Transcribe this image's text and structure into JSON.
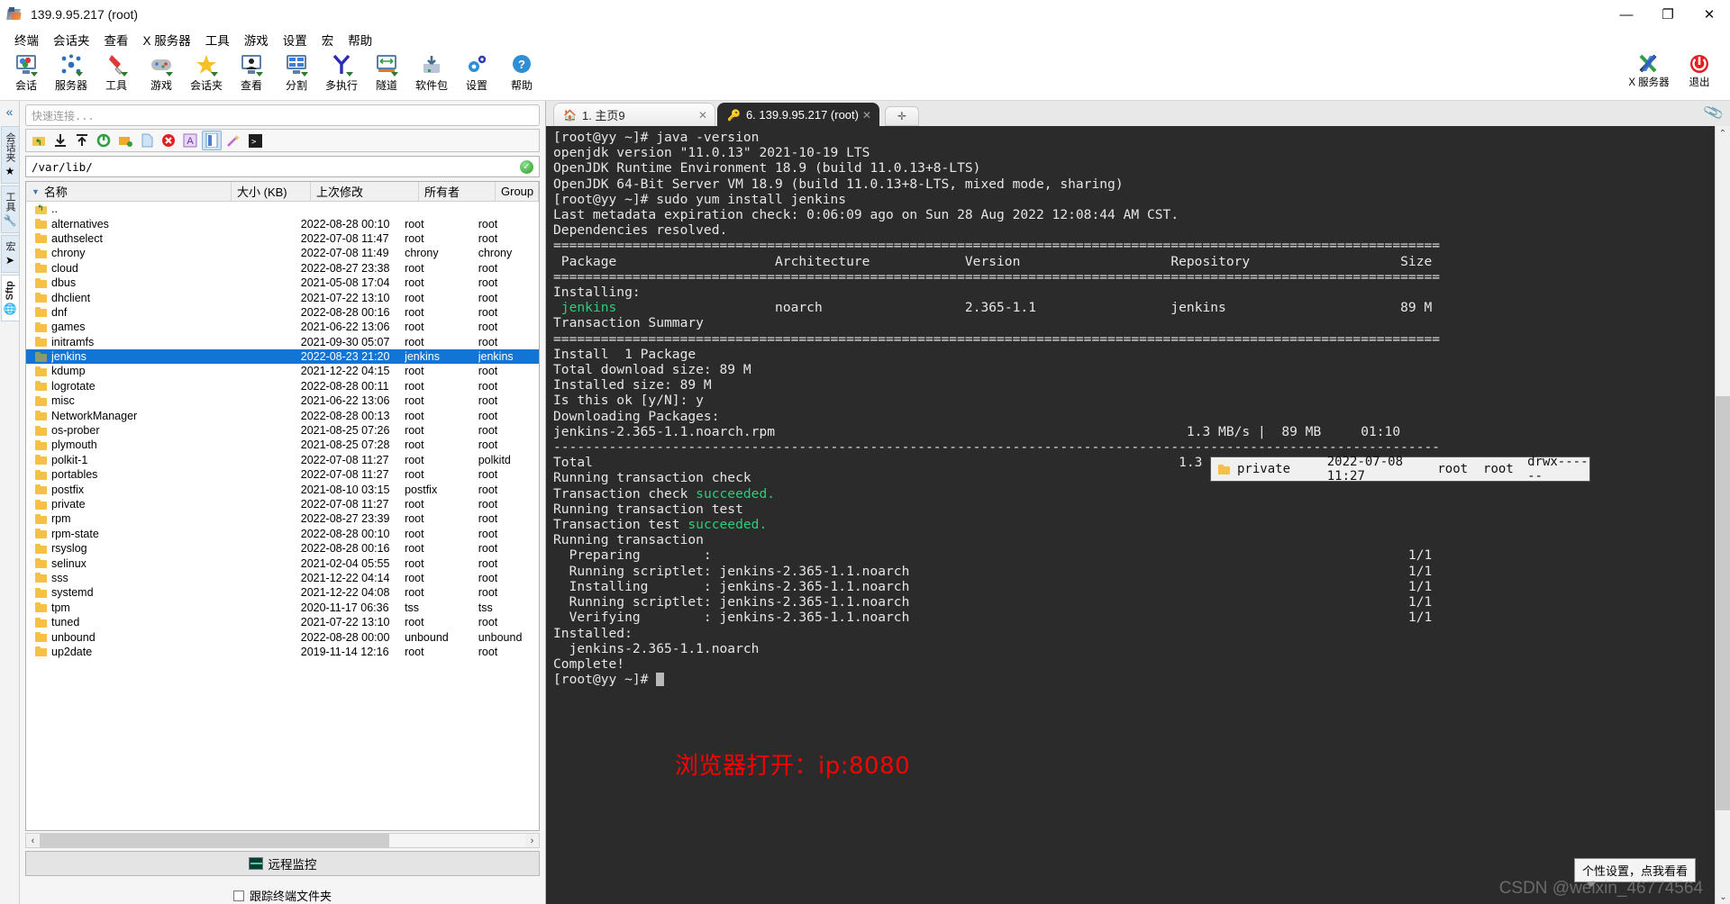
{
  "window": {
    "title": "139.9.95.217 (root)",
    "minimize": "—",
    "maximize": "❐",
    "close": "✕"
  },
  "menubar": [
    "终端",
    "会话夹",
    "查看",
    "X 服务器",
    "工具",
    "游戏",
    "设置",
    "宏",
    "帮助"
  ],
  "toolbar": {
    "buttons": [
      {
        "label": "会话",
        "icon": "session-icon"
      },
      {
        "label": "服务器",
        "icon": "servers-icon"
      },
      {
        "label": "工具",
        "icon": "tools-icon"
      },
      {
        "label": "游戏",
        "icon": "games-icon"
      },
      {
        "label": "会话夹",
        "icon": "sessions-folder-icon"
      },
      {
        "label": "查看",
        "icon": "view-icon"
      },
      {
        "label": "分割",
        "icon": "split-icon"
      },
      {
        "label": "多执行",
        "icon": "multiexec-icon"
      },
      {
        "label": "隧道",
        "icon": "tunneling-icon"
      },
      {
        "label": "软件包",
        "icon": "packages-icon"
      },
      {
        "label": "设置",
        "icon": "settings-icon"
      },
      {
        "label": "帮助",
        "icon": "help-icon"
      }
    ],
    "right_buttons": [
      {
        "label": "X 服务器",
        "icon": "xserver-icon"
      },
      {
        "label": "退出",
        "icon": "power-exit-icon"
      }
    ]
  },
  "rail": {
    "collapse": "«",
    "tabs": [
      {
        "label": "会话夹",
        "icon": "star-icon",
        "active": false
      },
      {
        "label": "工具",
        "icon": "swissknife-icon",
        "active": false
      },
      {
        "label": "宏",
        "icon": "paperplane-icon",
        "active": false
      },
      {
        "label": "Sftp",
        "icon": "globe-icon",
        "active": true
      }
    ]
  },
  "sftp": {
    "quick_connect_placeholder": "快速连接...",
    "toolbar_icons": [
      "up-folder-icon",
      "download-icon",
      "upload-icon",
      "refresh-icon",
      "new-folder-icon",
      "new-file-icon",
      "delete-icon",
      "rename-icon",
      "bookmark-icon",
      "wand-icon",
      "terminal-icon"
    ],
    "path": "/var/lib/",
    "path_ok_icon": "check-circle-icon",
    "columns": [
      "名称",
      "大小 (KB)",
      "上次修改",
      "所有者",
      "Group"
    ],
    "size_unit": "(KB)",
    "parent_entry": "..",
    "rows": [
      {
        "name": "alternatives",
        "size": "",
        "modified": "2022-08-28 00:10",
        "owner": "root",
        "group": "root"
      },
      {
        "name": "authselect",
        "size": "",
        "modified": "2022-07-08 11:47",
        "owner": "root",
        "group": "root"
      },
      {
        "name": "chrony",
        "size": "",
        "modified": "2022-07-08 11:49",
        "owner": "chrony",
        "group": "chrony"
      },
      {
        "name": "cloud",
        "size": "",
        "modified": "2022-08-27 23:38",
        "owner": "root",
        "group": "root"
      },
      {
        "name": "dbus",
        "size": "",
        "modified": "2021-05-08 17:04",
        "owner": "root",
        "group": "root"
      },
      {
        "name": "dhclient",
        "size": "",
        "modified": "2021-07-22 13:10",
        "owner": "root",
        "group": "root"
      },
      {
        "name": "dnf",
        "size": "",
        "modified": "2022-08-28 00:16",
        "owner": "root",
        "group": "root"
      },
      {
        "name": "games",
        "size": "",
        "modified": "2021-06-22 13:06",
        "owner": "root",
        "group": "root"
      },
      {
        "name": "initramfs",
        "size": "",
        "modified": "2021-09-30 05:07",
        "owner": "root",
        "group": "root"
      },
      {
        "name": "jenkins",
        "size": "",
        "modified": "2022-08-23 21:20",
        "owner": "jenkins",
        "group": "jenkins",
        "selected": true
      },
      {
        "name": "kdump",
        "size": "",
        "modified": "2021-12-22 04:15",
        "owner": "root",
        "group": "root"
      },
      {
        "name": "logrotate",
        "size": "",
        "modified": "2022-08-28 00:11",
        "owner": "root",
        "group": "root"
      },
      {
        "name": "misc",
        "size": "",
        "modified": "2021-06-22 13:06",
        "owner": "root",
        "group": "root"
      },
      {
        "name": "NetworkManager",
        "size": "",
        "modified": "2022-08-28 00:13",
        "owner": "root",
        "group": "root"
      },
      {
        "name": "os-prober",
        "size": "",
        "modified": "2021-08-25 07:26",
        "owner": "root",
        "group": "root"
      },
      {
        "name": "plymouth",
        "size": "",
        "modified": "2021-08-25 07:28",
        "owner": "root",
        "group": "root"
      },
      {
        "name": "polkit-1",
        "size": "",
        "modified": "2022-07-08 11:27",
        "owner": "root",
        "group": "polkitd"
      },
      {
        "name": "portables",
        "size": "",
        "modified": "2022-07-08 11:27",
        "owner": "root",
        "group": "root"
      },
      {
        "name": "postfix",
        "size": "",
        "modified": "2021-08-10 03:15",
        "owner": "postfix",
        "group": "root"
      },
      {
        "name": "private",
        "size": "",
        "modified": "2022-07-08 11:27",
        "owner": "root",
        "group": "root"
      },
      {
        "name": "rpm",
        "size": "",
        "modified": "2022-08-27 23:39",
        "owner": "root",
        "group": "root"
      },
      {
        "name": "rpm-state",
        "size": "",
        "modified": "2022-08-28 00:10",
        "owner": "root",
        "group": "root"
      },
      {
        "name": "rsyslog",
        "size": "",
        "modified": "2022-08-28 00:16",
        "owner": "root",
        "group": "root"
      },
      {
        "name": "selinux",
        "size": "",
        "modified": "2021-02-04 05:55",
        "owner": "root",
        "group": "root"
      },
      {
        "name": "sss",
        "size": "",
        "modified": "2021-12-22 04:14",
        "owner": "root",
        "group": "root"
      },
      {
        "name": "systemd",
        "size": "",
        "modified": "2021-12-22 04:08",
        "owner": "root",
        "group": "root"
      },
      {
        "name": "tpm",
        "size": "",
        "modified": "2020-11-17 06:36",
        "owner": "tss",
        "group": "tss"
      },
      {
        "name": "tuned",
        "size": "",
        "modified": "2021-07-22 13:10",
        "owner": "root",
        "group": "root"
      },
      {
        "name": "unbound",
        "size": "",
        "modified": "2022-08-28 00:00",
        "owner": "unbound",
        "group": "unbound"
      },
      {
        "name": "up2date",
        "size": "",
        "modified": "2019-11-14 12:16",
        "owner": "root",
        "group": "root"
      }
    ],
    "remote_monitoring": "远程监控",
    "follow_terminal_folder": "跟踪终端文件夹"
  },
  "drag_tooltip": {
    "name": "private",
    "modified": "2022-07-08 11:27",
    "owner": "root",
    "group": "root",
    "perms": "drwx------"
  },
  "tabs": [
    {
      "label": "1. 主页9",
      "icon": "home-icon",
      "active": false,
      "close": "✕"
    },
    {
      "label": "6. 139.9.95.217 (root)",
      "icon": "ssh-key-icon",
      "active": true,
      "close": "✕"
    }
  ],
  "tab_add": "✛",
  "terminal": {
    "lines": [
      "[root@yy ~]# java -version",
      "openjdk version \"11.0.13\" 2021-10-19 LTS",
      "OpenJDK Runtime Environment 18.9 (build 11.0.13+8-LTS)",
      "OpenJDK 64-Bit Server VM 18.9 (build 11.0.13+8-LTS, mixed mode, sharing)",
      "[root@yy ~]# sudo yum install jenkins",
      "Last metadata expiration check: 0:06:09 ago on Sun 28 Aug 2022 12:08:44 AM CST.",
      "Dependencies resolved.",
      "================================================================================================================",
      " Package                    Architecture            Version                   Repository                   Size",
      "================================================================================================================",
      "Installing:",
      " jenkins                    noarch                  2.365-1.1                 jenkins                      89 M",
      "",
      "Transaction Summary",
      "================================================================================================================",
      "Install  1 Package",
      "",
      "Total download size: 89 M",
      "Installed size: 89 M",
      "Is this ok [y/N]: y",
      "Downloading Packages:",
      "jenkins-2.365-1.1.noarch.rpm                                                    1.3 MB/s |  89 MB     01:10",
      "----------------------------------------------------------------------------------------------------------------",
      "Total                                                                          1.3 MB/s |  89 MB     01:10",
      "Running transaction check",
      "Transaction check succeeded.",
      "Running transaction test",
      "Transaction test succeeded.",
      "Running transaction",
      "  Preparing        :                                                                                        1/1",
      "  Running scriptlet: jenkins-2.365-1.1.noarch                                                               1/1",
      "  Installing       : jenkins-2.365-1.1.noarch                                                               1/1",
      "  Running scriptlet: jenkins-2.365-1.1.noarch                                                               1/1",
      "  Verifying        : jenkins-2.365-1.1.noarch                                                               1/1",
      "",
      "Installed:",
      "  jenkins-2.365-1.1.noarch",
      "",
      "Complete!"
    ],
    "prompt": "[root@yy ~]# ",
    "annotation": "浏览器打开：ip:8080"
  },
  "tooltip": "个性设置，点我看看",
  "watermark": "CSDN @weixin_46774564",
  "colors": {
    "terminal_bg": "#2b2b2b",
    "terminal_fg": "#e6e6e6",
    "terminal_green": "#25d07a",
    "selection_blue": "#1274d4",
    "annotation_red": "#ff0000"
  }
}
